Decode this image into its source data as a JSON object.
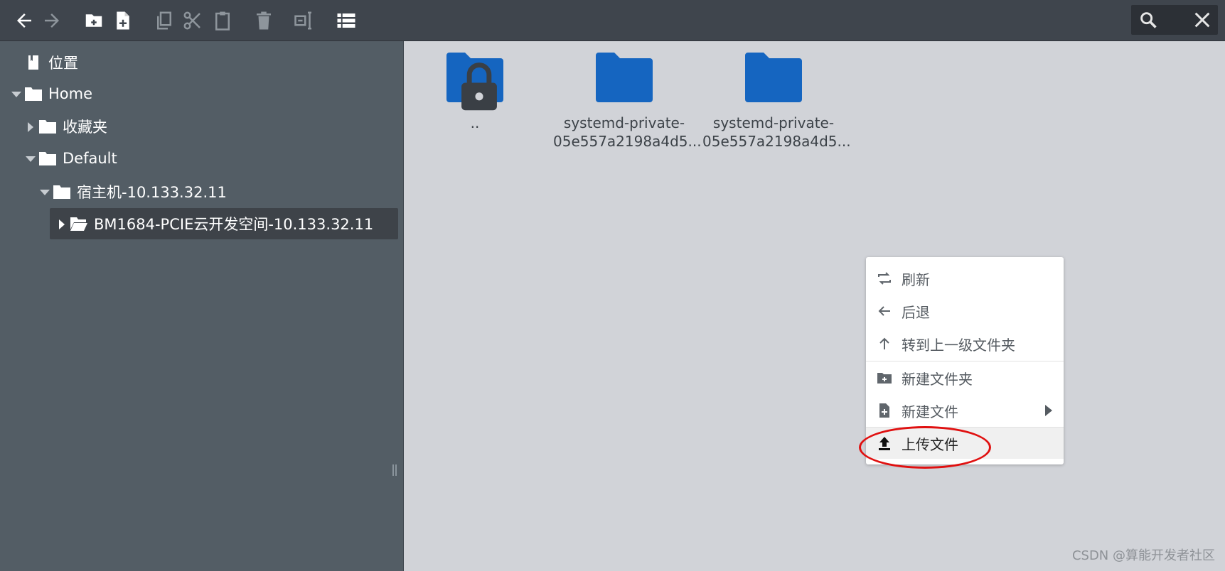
{
  "toolbar": {
    "buttons": [
      {
        "icon": "arrow-left-icon"
      },
      {
        "icon": "arrow-right-icon"
      },
      {
        "icon": "new-folder-icon"
      },
      {
        "icon": "new-file-icon"
      },
      {
        "icon": "copy-icon"
      },
      {
        "icon": "cut-icon"
      },
      {
        "icon": "paste-icon"
      },
      {
        "icon": "delete-icon"
      },
      {
        "icon": "rename-icon"
      },
      {
        "icon": "list-view-icon"
      }
    ],
    "search": {
      "icon": "search-icon",
      "close_icon": "close-icon"
    }
  },
  "sidebar": {
    "items": [
      {
        "label": "位置",
        "icon": "bookmark-icon"
      },
      {
        "label": "Home",
        "icon": "folder-icon",
        "expanded": true
      },
      {
        "label": "收藏夹",
        "icon": "folder-icon",
        "expanded": false
      },
      {
        "label": "Default",
        "icon": "folder-icon",
        "expanded": true
      },
      {
        "label": "宿主机-10.133.32.11",
        "icon": "folder-icon",
        "expanded": true
      },
      {
        "label": "BM1684-PCIE云开发空间-10.133.32.11",
        "icon": "folder-open-icon",
        "expanded": false,
        "selected": true
      }
    ]
  },
  "files": [
    {
      "name": "..",
      "icon": "folder-icon",
      "locked": true
    },
    {
      "name": "systemd-private-05e557a2198a4d5...",
      "name_line1": "systemd-private-",
      "name_line2": "05e557a2198a4d5...",
      "icon": "folder-icon"
    },
    {
      "name": "systemd-private-05e557a2198a4d5...",
      "name_line1": "systemd-private-",
      "name_line2": "05e557a2198a4d5...",
      "icon": "folder-icon"
    }
  ],
  "context_menu": {
    "items": [
      {
        "label": "刷新",
        "icon": "refresh-icon"
      },
      {
        "label": "后退",
        "icon": "arrow-left-icon"
      },
      {
        "label": "转到上一级文件夹",
        "icon": "arrow-up-icon"
      },
      {
        "label": "新建文件夹",
        "icon": "new-folder-icon"
      },
      {
        "label": "新建文件",
        "icon": "new-file-icon",
        "submenu": true
      },
      {
        "label": "上传文件",
        "icon": "upload-icon",
        "highlighted": true
      }
    ]
  },
  "watermark": "CSDN @算能开发者社区",
  "colors": {
    "toolbar_bg": "#3f454d",
    "sidebar_bg": "#535d65",
    "content_bg": "#d1d3d8",
    "folder_blue": "#1565c0",
    "highlight_red": "#e01010"
  }
}
